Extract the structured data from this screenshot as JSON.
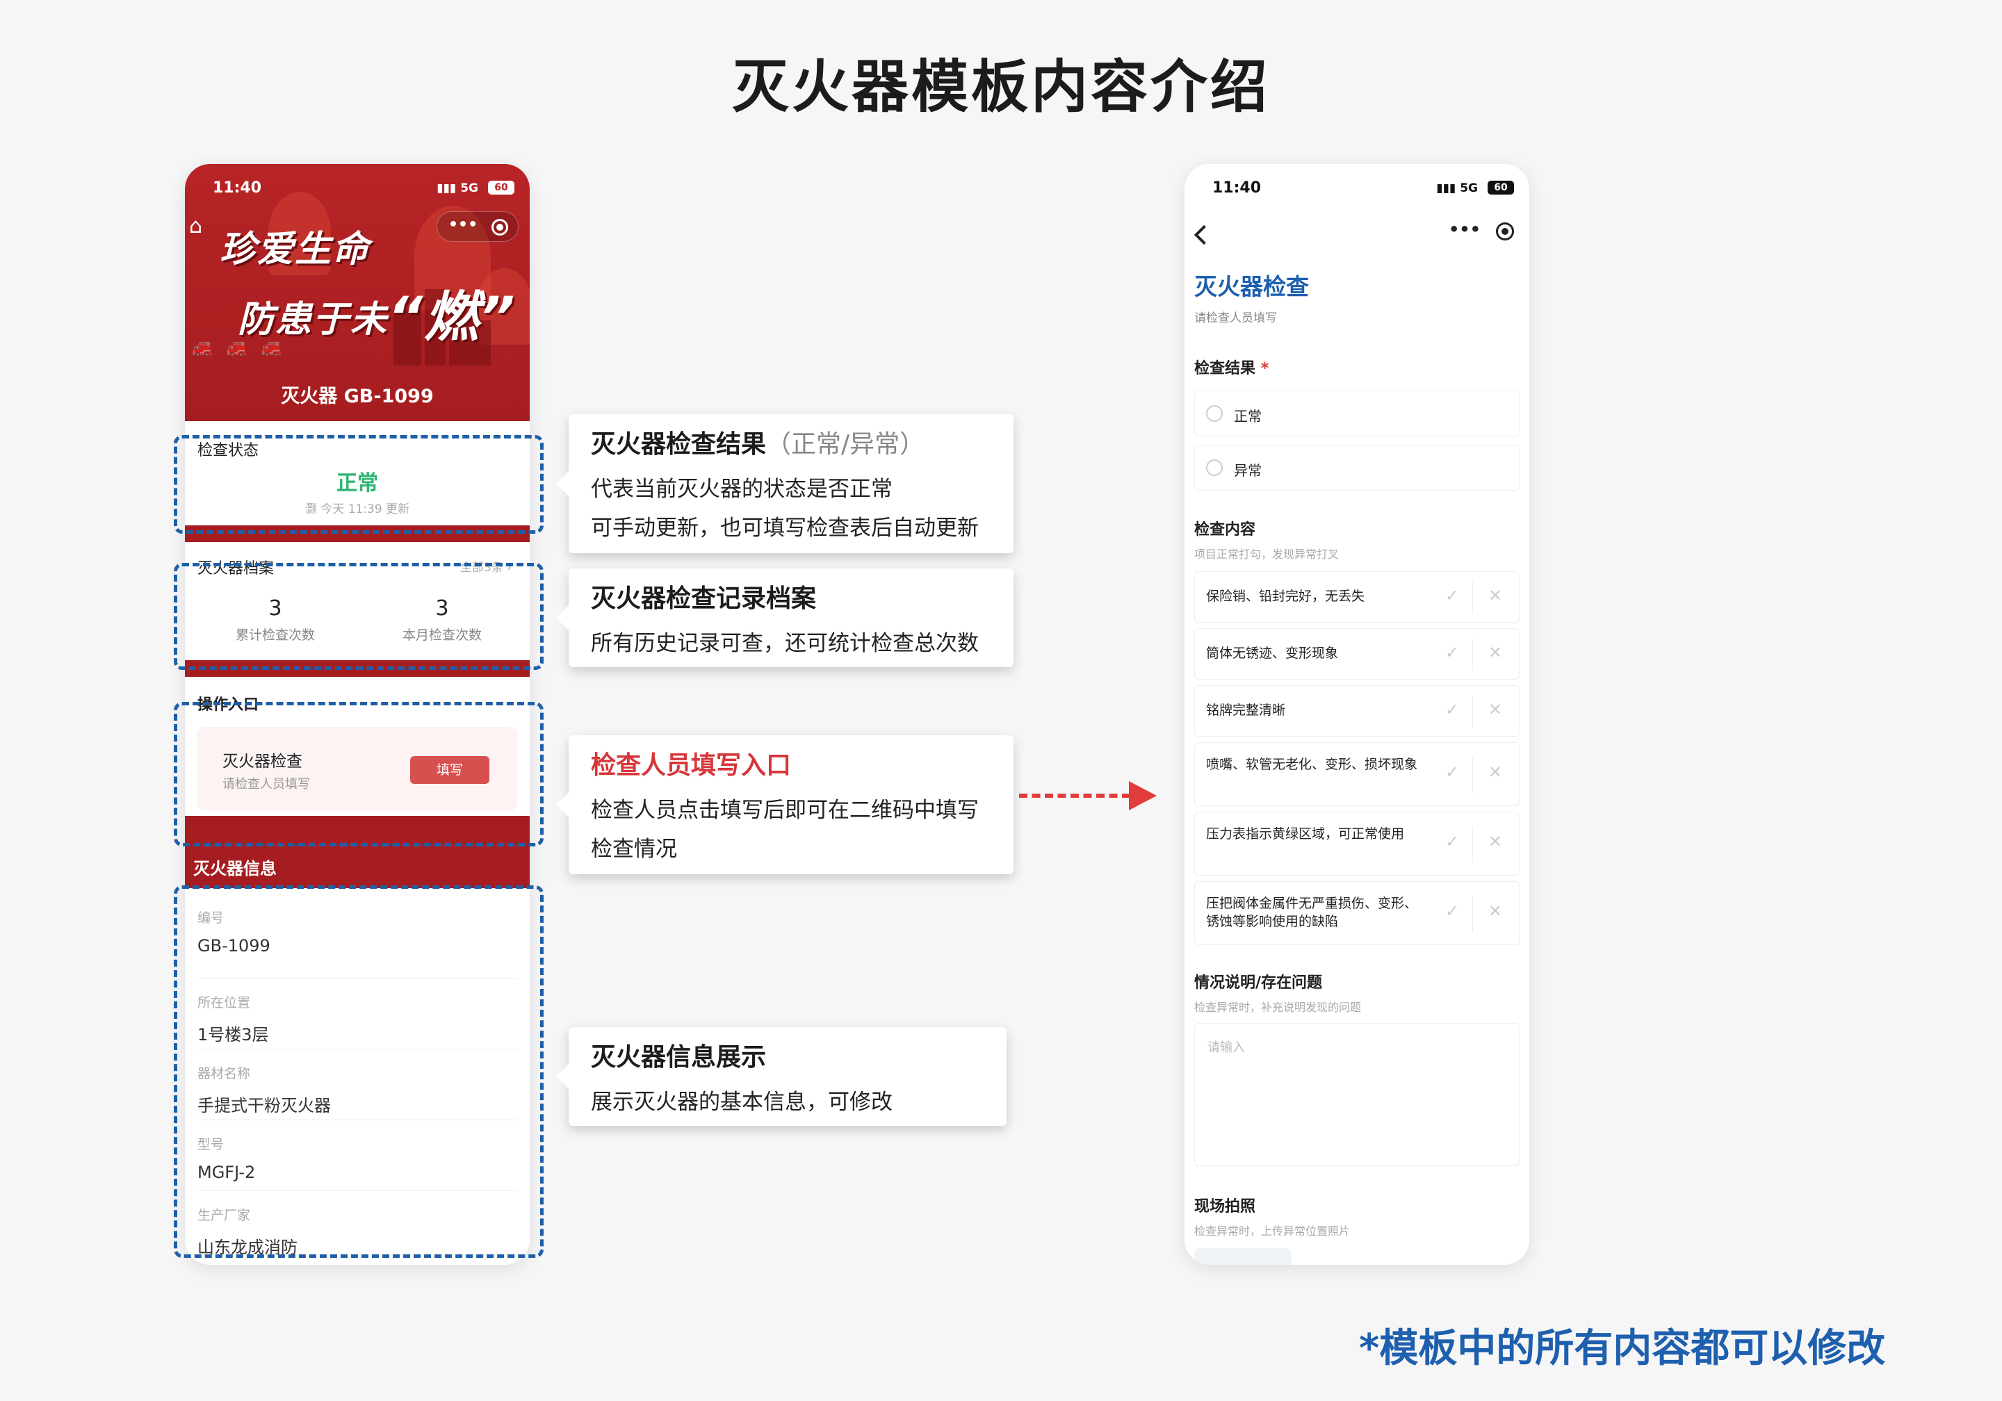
{
  "page": {
    "title": "灭火器模板内容介绍",
    "footnote": "*模板中的所有内容都可以修改"
  },
  "phone_left": {
    "status_bar": {
      "time": "11:40",
      "network": "5G",
      "battery": "60"
    },
    "hero": {
      "slogan_line1": "珍爱生命",
      "slogan_line2": "防患于未",
      "slogan_emphasis": "“燃”",
      "device_name": "灭火器 GB-1099"
    },
    "check_status": {
      "label": "检查状态",
      "value": "正常",
      "updated": "灏 今天 11:39 更新"
    },
    "archive": {
      "label": "灭火器档案",
      "all_link": "全部3条 ›",
      "stats": [
        {
          "value": "3",
          "label": "累计检查次数"
        },
        {
          "value": "3",
          "label": "本月检查次数"
        }
      ]
    },
    "entry": {
      "label": "操作入口",
      "title": "灭火器检查",
      "subtitle": "请检查人员填写",
      "button": "填写"
    },
    "info": {
      "header": "灭火器信息",
      "rows": [
        {
          "key": "编号",
          "value": "GB-1099"
        },
        {
          "key": "所在位置",
          "value": "1号楼3层"
        },
        {
          "key": "器材名称",
          "value": "手提式干粉灭火器"
        },
        {
          "key": "型号",
          "value": "MGFJ-2"
        },
        {
          "key": "生产厂家",
          "value": "山东龙成消防"
        }
      ]
    }
  },
  "callouts": [
    {
      "title": "灭火器检查结果",
      "title_note": "（正常/异常）",
      "lines": [
        "代表当前灭火器的状态是否正常",
        "可手动更新，也可填写检查表后自动更新"
      ]
    },
    {
      "title": "灭火器检查记录档案",
      "lines": [
        "所有历史记录可查，还可统计检查总次数"
      ]
    },
    {
      "title": "检查人员填写入口",
      "lines": [
        "检查人员点击填写后即可在二维码中填写",
        "检查情况"
      ]
    },
    {
      "title": "灭火器信息展示",
      "lines": [
        "展示灭火器的基本信息，可修改"
      ]
    }
  ],
  "phone_right": {
    "status_bar": {
      "time": "11:40",
      "network": "5G",
      "battery": "60"
    },
    "form_title": "灭火器检查",
    "form_subtitle": "请检查人员填写",
    "result": {
      "label": "检查结果",
      "required_mark": "*",
      "options": [
        "正常",
        "异常"
      ]
    },
    "content": {
      "label": "检查内容",
      "hint": "项目正常打勾，发现异常打叉",
      "items": [
        "保险销、铅封完好，无丢失",
        "筒体无锈迹、变形现象",
        "铭牌完整清晰",
        "喷嘴、软管无老化、变形、损坏现象",
        "压力表指示黄绿区域，可正常使用",
        "压把阀体金属件无严重损伤、变形、锈蚀等影响使用的缺陷"
      ],
      "ok_symbol": "✓",
      "no_symbol": "✕"
    },
    "notes": {
      "label": "情况说明/存在问题",
      "hint": "检查异常时，补充说明发现的问题",
      "placeholder": "请输入"
    },
    "photo": {
      "label": "现场拍照",
      "hint": "检查异常时，上传异常位置照片"
    }
  },
  "colors": {
    "brand_red": "#a51d20",
    "accent_blue": "#1e5fae",
    "status_green": "#2bb673",
    "arrow_red": "#e03c3c"
  }
}
